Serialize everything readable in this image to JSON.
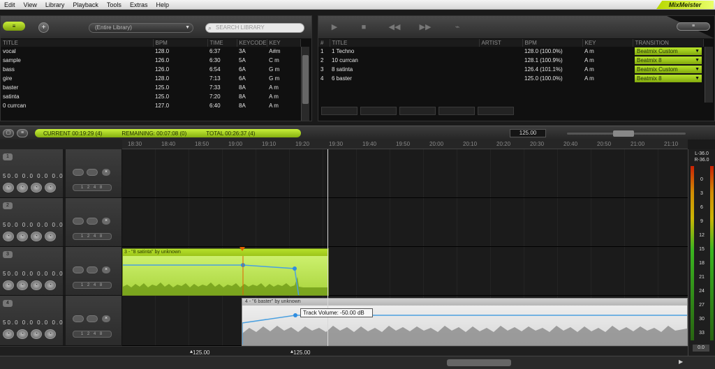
{
  "menu": [
    "Edit",
    "View",
    "Library",
    "Playback",
    "Tools",
    "Extras",
    "Help"
  ],
  "brand": "MixMeister",
  "library": {
    "toggle_label": "≡",
    "add_label": "+",
    "filter": "(Entire Library)",
    "search_placeholder": "SEARCH LIBRARY",
    "columns": [
      "TITLE",
      "BPM",
      "TIME",
      "KEYCODE",
      "KEY"
    ],
    "rows": [
      [
        "vocal",
        "128.0",
        "6:37",
        "3A",
        "A#m"
      ],
      [
        "sample",
        "126.0",
        "6:30",
        "5A",
        "C m"
      ],
      [
        "bass",
        "126.0",
        "6:54",
        "6A",
        "G m"
      ],
      [
        "gire",
        "128.0",
        "7:13",
        "6A",
        "G m"
      ],
      [
        "baster",
        "125.0",
        "7:33",
        "8A",
        "A m"
      ],
      [
        "satinta",
        "125.0",
        "7:20",
        "8A",
        "A m"
      ],
      [
        "0 currcan",
        "127.0",
        "6:40",
        "8A",
        "A m"
      ]
    ]
  },
  "playlist": {
    "toggle_label": "≡",
    "columns": [
      "#",
      "TITLE",
      "ARTIST",
      "BPM",
      "KEY",
      "TRANSITION"
    ],
    "rows": [
      [
        "1",
        "1 Techno",
        "",
        "128.0 (100.0%)",
        "A m",
        "Beatmix Custom"
      ],
      [
        "2",
        "10 currcan",
        "",
        "128.1 (100.9%)",
        "A m",
        "Beatmix 8"
      ],
      [
        "3",
        "8 satinta",
        "",
        "126.4 (101.1%)",
        "A m",
        "Beatmix Custom"
      ],
      [
        "4",
        "6 baster",
        "",
        "125.0 (100.0%)",
        "A m",
        "Beatmix 8"
      ]
    ]
  },
  "status": {
    "current": "CURRENT 00:19:29 (4)",
    "remaining": "REMAINING: 00:07:08 (0)",
    "total": "TOTAL 00:26:37 (4)",
    "bpm": "125.00"
  },
  "timeline": [
    "18:30",
    "18:40",
    "18:50",
    "19:00",
    "19:10",
    "19:20",
    "19:30",
    "19:40",
    "19:50",
    "20:00",
    "20:10",
    "20:20",
    "20:30",
    "20:40",
    "20:50",
    "21:00",
    "21:10"
  ],
  "lanes": {
    "nums": "50.0 0.0 0.0 0.0",
    "steps": "1 2 4 8"
  },
  "clips": {
    "clip1_title": "3 - \"8 satinta\" by unknown",
    "clip2_title": "4 - \"6 baster\" by unknown",
    "tooltip": "Track Volume: -50.00 dB"
  },
  "vu": {
    "top": [
      "L-36.0",
      "R-36.0"
    ],
    "scale": [
      "0",
      "3",
      "6",
      "9",
      "12",
      "15",
      "18",
      "21",
      "24",
      "27",
      "30",
      "33"
    ],
    "bottom": "0.0"
  },
  "bottom_bpm": [
    "125.00",
    "125.00"
  ]
}
